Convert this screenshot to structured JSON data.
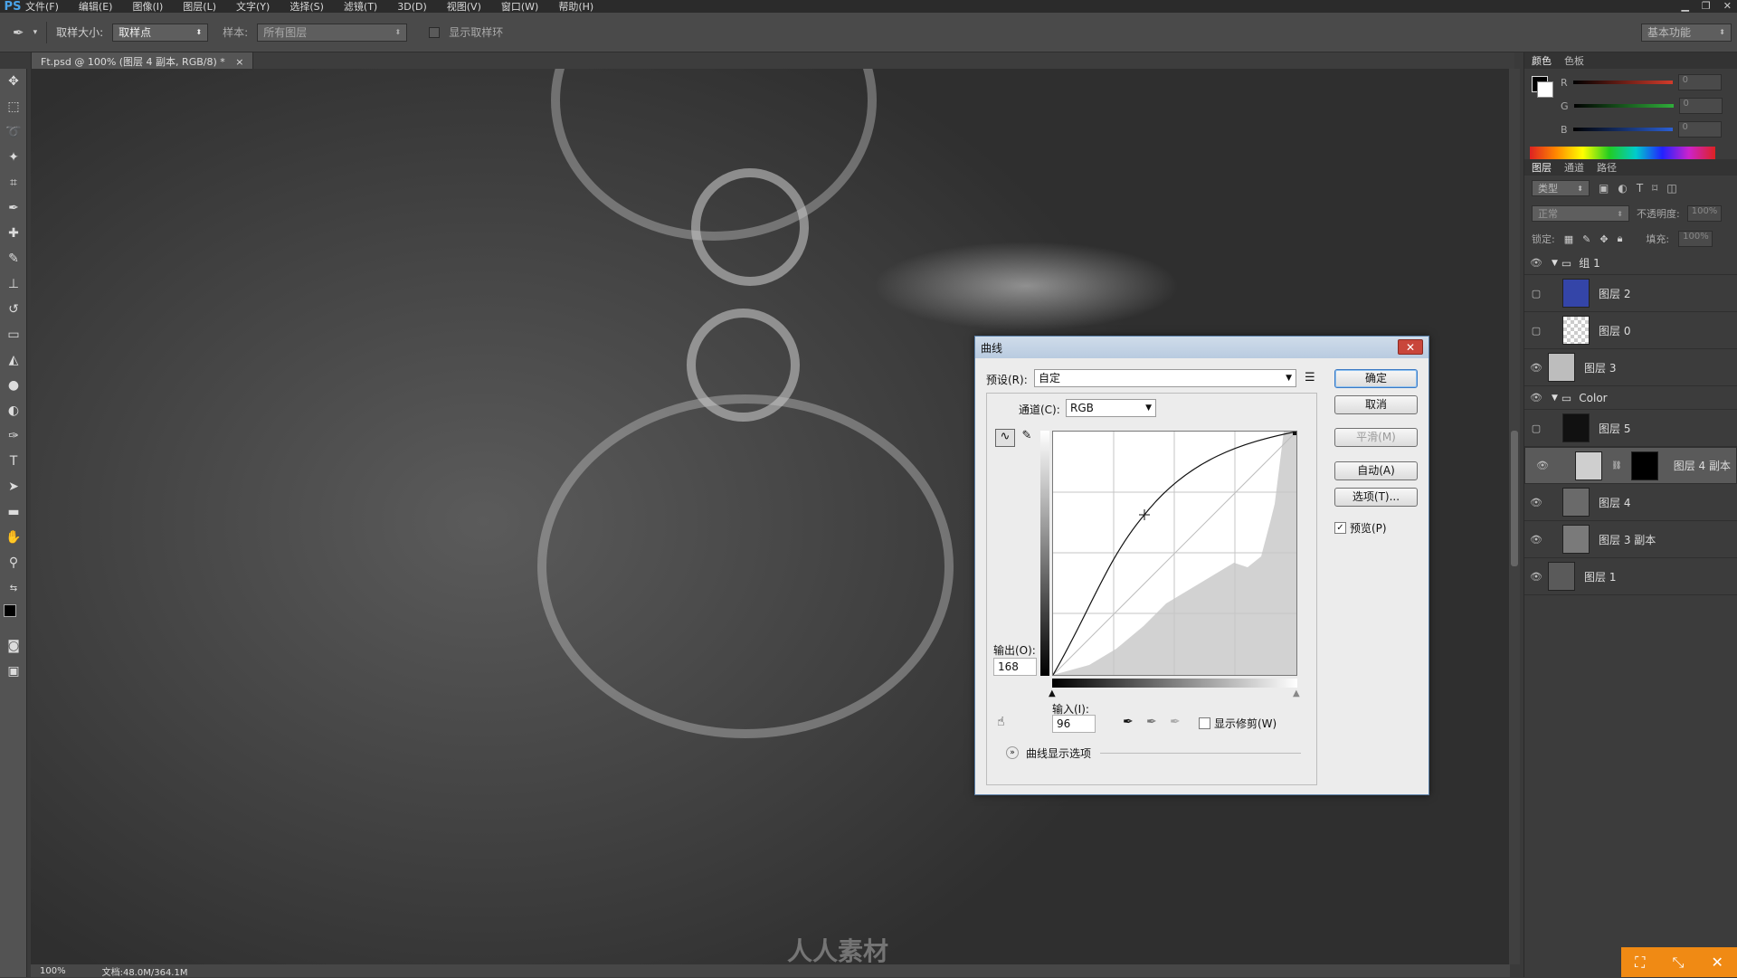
{
  "menu": {
    "logo": "PS",
    "items": [
      "文件(F)",
      "编辑(E)",
      "图像(I)",
      "图层(L)",
      "文字(Y)",
      "选择(S)",
      "滤镜(T)",
      "3D(D)",
      "视图(V)",
      "窗口(W)",
      "帮助(H)"
    ]
  },
  "options": {
    "sample_size_label": "取样大小:",
    "sample_size_value": "取样点",
    "sample_label": "样本:",
    "sample_value": "所有图层",
    "show_ring_label": "显示取样环",
    "workspace": "基本功能"
  },
  "document": {
    "tab_title": "Ft.psd @ 100% (图层 4 副本, RGB/8) *",
    "zoom": "100%",
    "doc_size": "文档:48.0M/364.1M"
  },
  "color_panel": {
    "tabs": [
      "颜色",
      "色板"
    ],
    "channels": [
      {
        "label": "R",
        "value": "0",
        "color": "#d23b2b"
      },
      {
        "label": "G",
        "value": "0",
        "color": "#2fae3a"
      },
      {
        "label": "B",
        "value": "0",
        "color": "#2b5fd2"
      }
    ]
  },
  "layers_panel": {
    "tabs": [
      "图层",
      "通道",
      "路径"
    ],
    "kind_filter": "类型",
    "blend_mode": "正常",
    "opacity_label": "不透明度:",
    "opacity_value": "100%",
    "lock_label": "锁定:",
    "fill_label": "填充:",
    "fill_value": "100%",
    "layers": [
      {
        "name": "组 1",
        "type": "group",
        "visible": true
      },
      {
        "name": "图层 2",
        "type": "layer",
        "visible": false,
        "thumb": "#3445a8"
      },
      {
        "name": "图层 0",
        "type": "layer",
        "visible": false,
        "thumb": "#d8d8d8"
      },
      {
        "name": "图层 3",
        "type": "layer",
        "visible": true,
        "thumb": "#bdbdbd"
      },
      {
        "name": "Color",
        "type": "group",
        "visible": true
      },
      {
        "name": "图层 5",
        "type": "layer",
        "visible": false,
        "thumb": "#111111"
      },
      {
        "name": "图层 4 副本",
        "type": "layer",
        "visible": true,
        "thumb": "#cfcfcf",
        "selected": true
      },
      {
        "name": "图层 4",
        "type": "layer",
        "visible": true,
        "thumb": "#6a6a6a"
      },
      {
        "name": "图层 3 副本",
        "type": "layer",
        "visible": true,
        "thumb": "#7a7a7a"
      },
      {
        "name": "图层 1",
        "type": "layer",
        "visible": true,
        "thumb": "#5a5a5a"
      }
    ]
  },
  "curves_dialog": {
    "title": "曲线",
    "preset_label": "预设(R):",
    "preset_value": "自定",
    "channel_label": "通道(C):",
    "channel_value": "RGB",
    "output_label": "输出(O):",
    "output_value": "168",
    "input_label": "输入(I):",
    "input_value": "96",
    "show_clipping_label": "显示修剪(W)",
    "curve_options_label": "曲线显示选项",
    "buttons": {
      "ok": "确定",
      "cancel": "取消",
      "smooth": "平滑(M)",
      "auto": "自动(A)",
      "options": "选项(T)..."
    },
    "preview_label": "预览(P)",
    "preview_checked": true
  },
  "watermark": "人人素材"
}
